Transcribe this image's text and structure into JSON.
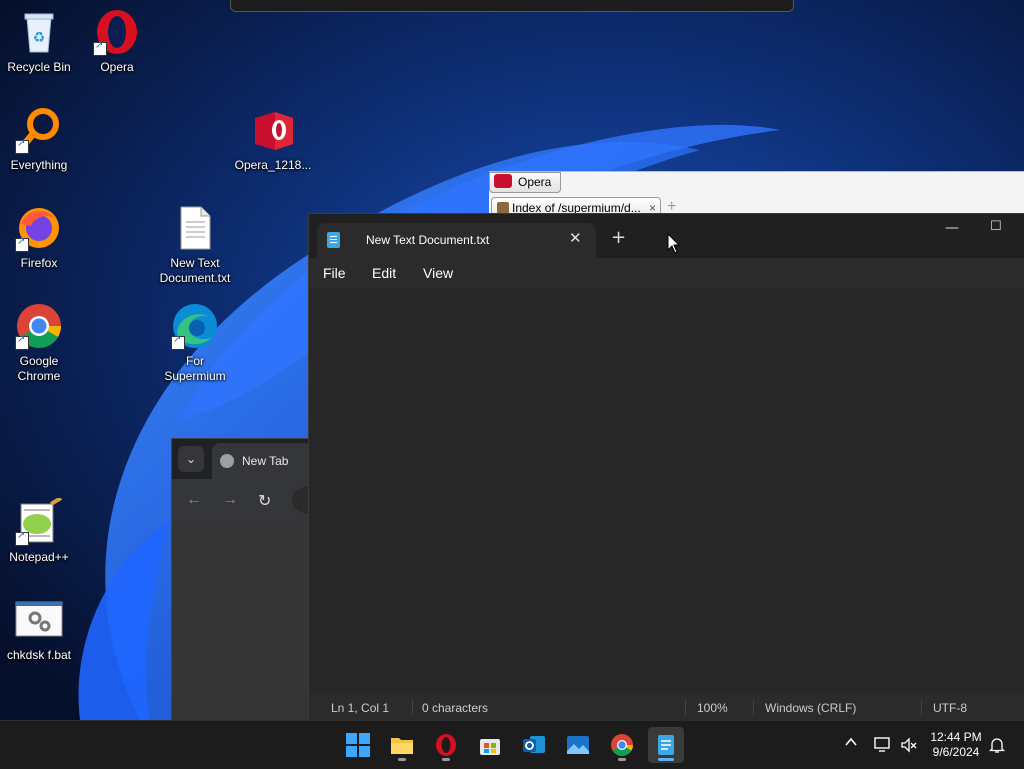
{
  "desktop": {
    "icons": [
      {
        "id": "recycle-bin",
        "label": "Recycle Bin"
      },
      {
        "id": "opera",
        "label": "Opera"
      },
      {
        "id": "everything",
        "label": "Everything"
      },
      {
        "id": "opera-installer",
        "label": "Opera_1218..."
      },
      {
        "id": "firefox",
        "label": "Firefox"
      },
      {
        "id": "new-text-document",
        "label": "New Text Document.txt"
      },
      {
        "id": "google-chrome",
        "label": "Google Chrome"
      },
      {
        "id": "for-supermium",
        "label": "For Supermium"
      },
      {
        "id": "notepadpp",
        "label": "Notepad++"
      },
      {
        "id": "chkdsk-bat",
        "label": "chkdsk f.bat"
      }
    ]
  },
  "opera_window": {
    "menu_label": "Opera",
    "tab_title": "Index of /supermium/d...",
    "tab_close": "×",
    "new_tab": "+"
  },
  "chrome_window": {
    "tab_title": "New Tab"
  },
  "notepad": {
    "tab_title": "New Text Document.txt",
    "tab_close": "✕",
    "add_tab": "+",
    "menu": {
      "file": "File",
      "edit": "Edit",
      "view": "View"
    },
    "status": {
      "position": "Ln 1, Col 1",
      "characters": "0 characters",
      "zoom": "100%",
      "line_ending": "Windows (CRLF)",
      "encoding": "UTF-8"
    }
  },
  "taskbar": {
    "clock_time": "12:44 PM",
    "clock_date": "9/6/2024"
  },
  "colors": {
    "accent": "#5fb2f2",
    "notepad_bg": "#272727",
    "taskbar_bg": "#1c1c1c",
    "opera_red": "#c8102e"
  }
}
